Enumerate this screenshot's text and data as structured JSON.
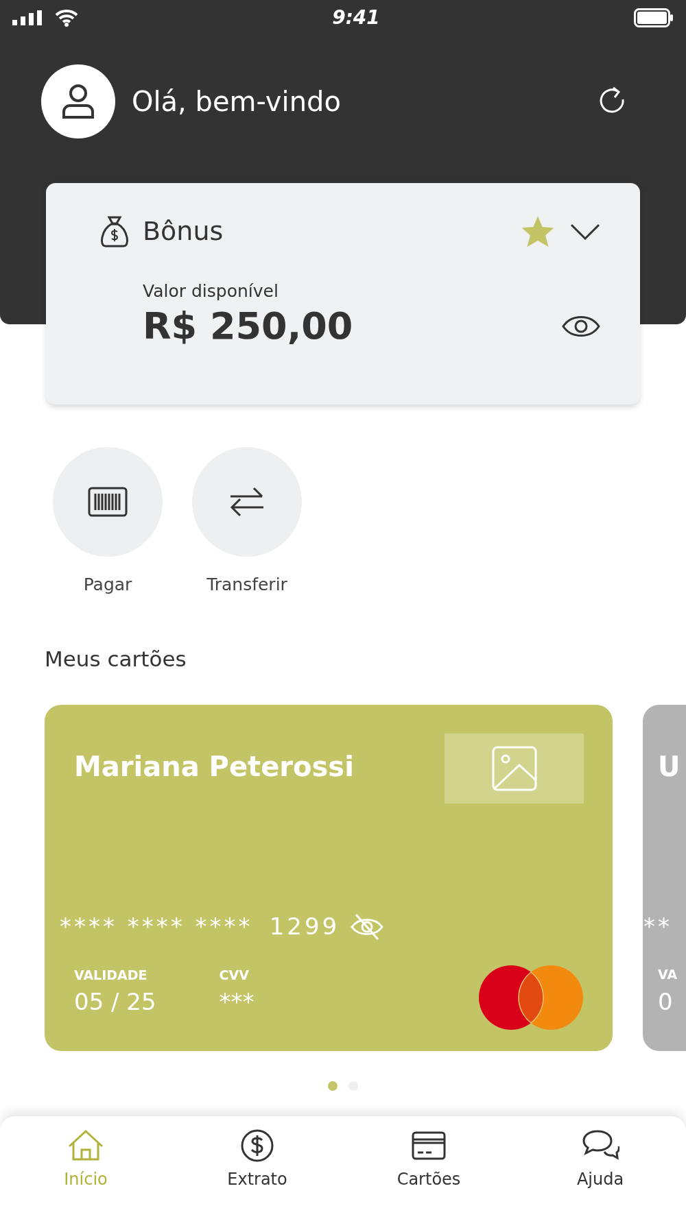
{
  "status_bar": {
    "time": "9:41"
  },
  "header": {
    "greeting": "Olá, bem-vindo"
  },
  "balance_card": {
    "title": "Bônus",
    "favorite": true,
    "expanded": false,
    "label": "Valor disponível",
    "amount": "R$ 250,00"
  },
  "actions": [
    {
      "kind": "pay",
      "label": "Pagar"
    },
    {
      "kind": "transfer",
      "label": "Transferir"
    }
  ],
  "cards_section": {
    "title": "Meus cartões"
  },
  "cards": [
    {
      "kind": "primary",
      "color": "#c3c466",
      "holder": "Mariana Peterossi",
      "number_masked": "**** **** ****",
      "last_digits": "1299",
      "expiry_label": "VALIDADE",
      "expiry": "05 / 25",
      "cvv_label": "CVV",
      "cvv": "***"
    },
    {
      "kind": "partial",
      "color": "#b3b3b3",
      "holder": "U",
      "number_masked": "**",
      "expiry_label": "VA",
      "expiry": "0"
    }
  ],
  "pager": [
    {
      "selected": true
    },
    {
      "selected": false
    }
  ],
  "bottom_nav": [
    {
      "kind": "home",
      "label": "Início",
      "selected": true
    },
    {
      "kind": "statement",
      "label": "Extrato",
      "selected": false
    },
    {
      "kind": "cards",
      "label": "Cartões",
      "selected": false
    },
    {
      "kind": "help",
      "label": "Ajuda",
      "selected": false
    }
  ]
}
